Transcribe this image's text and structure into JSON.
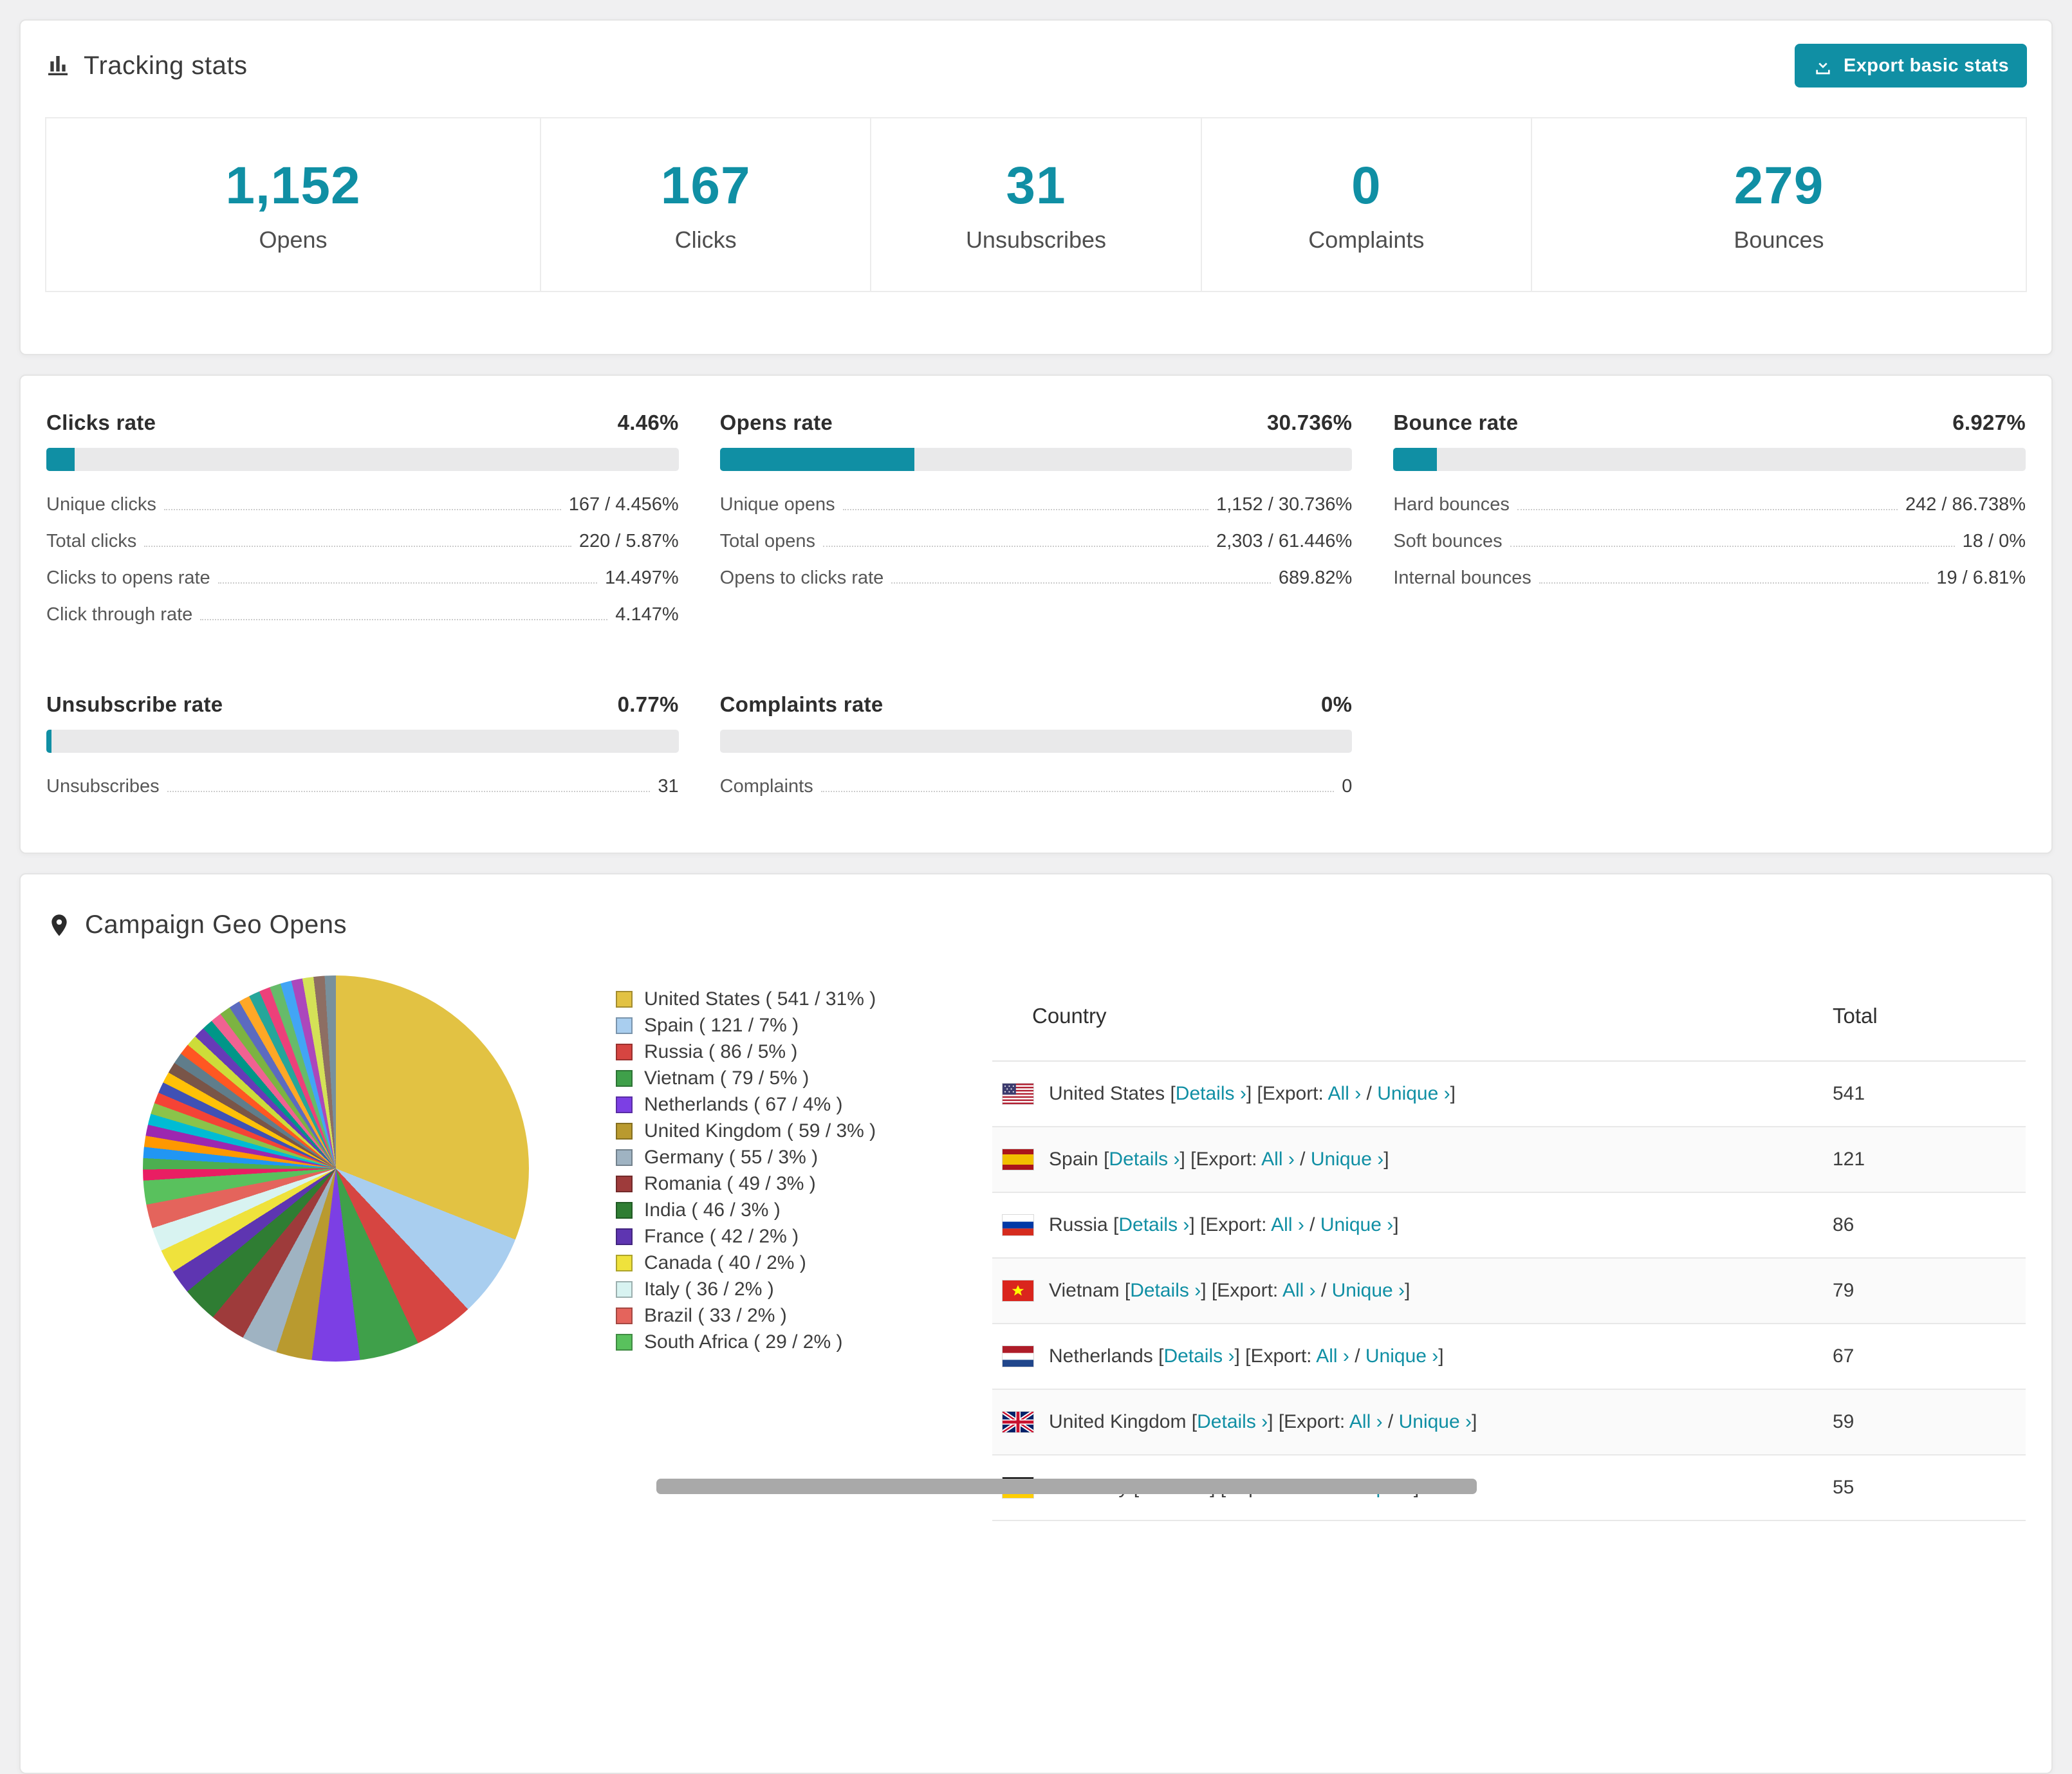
{
  "colors": {
    "accent": "#108fa4",
    "progress_track": "#e9e9ea"
  },
  "tracking": {
    "title": "Tracking stats",
    "export_button": "Export basic stats",
    "stats": [
      {
        "value": "1,152",
        "label": "Opens"
      },
      {
        "value": "167",
        "label": "Clicks"
      },
      {
        "value": "31",
        "label": "Unsubscribes"
      },
      {
        "value": "0",
        "label": "Complaints"
      },
      {
        "value": "279",
        "label": "Bounces"
      }
    ]
  },
  "rates": [
    {
      "name": "Clicks rate",
      "value": "4.46%",
      "percent": 4.46,
      "rows": [
        {
          "label": "Unique clicks",
          "value": "167 / 4.456%"
        },
        {
          "label": "Total clicks",
          "value": "220 / 5.87%"
        },
        {
          "label": "Clicks to opens rate",
          "value": "14.497%"
        },
        {
          "label": "Click through rate",
          "value": "4.147%"
        }
      ]
    },
    {
      "name": "Opens rate",
      "value": "30.736%",
      "percent": 30.736,
      "rows": [
        {
          "label": "Unique opens",
          "value": "1,152 / 30.736%"
        },
        {
          "label": "Total opens",
          "value": "2,303 / 61.446%"
        },
        {
          "label": "Opens to clicks rate",
          "value": "689.82%"
        }
      ]
    },
    {
      "name": "Bounce rate",
      "value": "6.927%",
      "percent": 6.927,
      "rows": [
        {
          "label": "Hard bounces",
          "value": "242 / 86.738%"
        },
        {
          "label": "Soft bounces",
          "value": "18 / 0%"
        },
        {
          "label": "Internal bounces",
          "value": "19 / 6.81%"
        }
      ]
    },
    {
      "name": "Unsubscribe rate",
      "value": "0.77%",
      "percent": 0.77,
      "rows": [
        {
          "label": "Unsubscribes",
          "value": "31"
        }
      ]
    },
    {
      "name": "Complaints rate",
      "value": "0%",
      "percent": 0,
      "rows": [
        {
          "label": "Complaints",
          "value": "0"
        }
      ]
    }
  ],
  "geo": {
    "title": "Campaign Geo Opens",
    "table": {
      "country_header": "Country",
      "total_header": "Total"
    },
    "link_labels": {
      "open_bracket": "[",
      "close_bracket": "]",
      "details": "Details ›",
      "export_prefix": "[Export:",
      "all": "All ›",
      "separator": "/",
      "unique": "Unique ›"
    },
    "legend": [
      {
        "label": "United States ( 541 / 31% )",
        "color": "#e2c243",
        "pct": 31
      },
      {
        "label": "Spain ( 121 / 7% )",
        "color": "#a9ceef",
        "pct": 7
      },
      {
        "label": "Russia ( 86 / 5% )",
        "color": "#d64541",
        "pct": 5
      },
      {
        "label": "Vietnam ( 79 / 5% )",
        "color": "#3fa04a",
        "pct": 5
      },
      {
        "label": "Netherlands ( 67 / 4% )",
        "color": "#7c3fe4",
        "pct": 4
      },
      {
        "label": "United Kingdom ( 59 / 3% )",
        "color": "#b99a2f",
        "pct": 3
      },
      {
        "label": "Germany ( 55 / 3% )",
        "color": "#9fb3c2",
        "pct": 3
      },
      {
        "label": "Romania ( 49 / 3% )",
        "color": "#9e3b3b",
        "pct": 3
      },
      {
        "label": "India ( 46 / 3% )",
        "color": "#2f7d33",
        "pct": 3
      },
      {
        "label": "France ( 42 / 2% )",
        "color": "#5e35b1",
        "pct": 2
      },
      {
        "label": "Canada ( 40 / 2% )",
        "color": "#efe23c",
        "pct": 2
      },
      {
        "label": "Italy ( 36 / 2% )",
        "color": "#d8f3f1",
        "pct": 2
      },
      {
        "label": "Brazil ( 33 / 2% )",
        "color": "#e4645c",
        "pct": 2
      },
      {
        "label": "South Africa ( 29 / 2% )",
        "color": "#59c15d",
        "pct": 2
      }
    ],
    "chart_data": {
      "type": "pie",
      "title": "Campaign Geo Opens",
      "slices": [
        {
          "label": "United States",
          "value": 541,
          "pct": 31,
          "color": "#e2c243"
        },
        {
          "label": "Spain",
          "value": 121,
          "pct": 7,
          "color": "#a9ceef"
        },
        {
          "label": "Russia",
          "value": 86,
          "pct": 5,
          "color": "#d64541"
        },
        {
          "label": "Vietnam",
          "value": 79,
          "pct": 5,
          "color": "#3fa04a"
        },
        {
          "label": "Netherlands",
          "value": 67,
          "pct": 4,
          "color": "#7c3fe4"
        },
        {
          "label": "United Kingdom",
          "value": 59,
          "pct": 3,
          "color": "#b99a2f"
        },
        {
          "label": "Germany",
          "value": 55,
          "pct": 3,
          "color": "#9fb3c2"
        },
        {
          "label": "Romania",
          "value": 49,
          "pct": 3,
          "color": "#9e3b3b"
        },
        {
          "label": "India",
          "value": 46,
          "pct": 3,
          "color": "#2f7d33"
        },
        {
          "label": "France",
          "value": 42,
          "pct": 2,
          "color": "#5e35b1"
        },
        {
          "label": "Canada",
          "value": 40,
          "pct": 2,
          "color": "#efe23c"
        },
        {
          "label": "Italy",
          "value": 36,
          "pct": 2,
          "color": "#d8f3f1"
        },
        {
          "label": "Brazil",
          "value": 33,
          "pct": 2,
          "color": "#e4645c"
        },
        {
          "label": "South Africa",
          "value": 29,
          "pct": 2,
          "color": "#59c15d"
        }
      ],
      "others": {
        "pct": 26,
        "colors": [
          "#e91e63",
          "#4caf50",
          "#2196f3",
          "#ff9800",
          "#9c27b0",
          "#00bcd4",
          "#8bc34a",
          "#f44336",
          "#3f51b5",
          "#ffc107",
          "#795548",
          "#607d8b",
          "#ff5722",
          "#cddc39",
          "#673ab7",
          "#009688",
          "#f06292",
          "#7cb342",
          "#5c6bc0",
          "#ffa726",
          "#26a69a",
          "#ec407a",
          "#66bb6a",
          "#42a5f5",
          "#ab47bc",
          "#d4e157",
          "#8d6e63",
          "#78909c"
        ]
      }
    },
    "rows": [
      {
        "country": "United States",
        "total": "541",
        "flag": "us"
      },
      {
        "country": "Spain",
        "total": "121",
        "flag": "es"
      },
      {
        "country": "Russia",
        "total": "86",
        "flag": "ru"
      },
      {
        "country": "Vietnam",
        "total": "79",
        "flag": "vn"
      },
      {
        "country": "Netherlands",
        "total": "67",
        "flag": "nl"
      },
      {
        "country": "United Kingdom",
        "total": "59",
        "flag": "gb"
      },
      {
        "country": "Germany",
        "total": "55",
        "flag": "de"
      }
    ]
  }
}
